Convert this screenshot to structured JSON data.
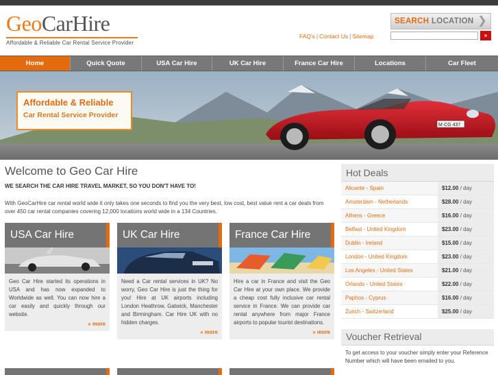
{
  "brand": {
    "logo_geo": "Geo",
    "logo_carhire": "CarHire",
    "tagline": "Affordable & Reliable Car Rental Service Provider"
  },
  "util_links": [
    "FAQ's",
    "Contact Us",
    "Sitemap"
  ],
  "search": {
    "label_part1": "SEARCH",
    "label_part2": "LOCATION",
    "go_label": "»",
    "placeholder": ""
  },
  "nav": [
    {
      "label": "Home",
      "active": true
    },
    {
      "label": "Quick Quote"
    },
    {
      "label": "USA Car Hire"
    },
    {
      "label": "UK Car Hire"
    },
    {
      "label": "France Car Hire"
    },
    {
      "label": "Locations"
    },
    {
      "label": "Car Fleet"
    }
  ],
  "banner": {
    "line1": "Affordable & Reliable",
    "line2": "Car Rental Service Provider",
    "plate": "M·CG 437"
  },
  "welcome": {
    "title": "Welcome to Geo Car Hire",
    "subtitle": "WE SEARCH THE CAR HIRE TRAVEL MARKET, SO YOU DON'T HAVE TO!",
    "body": "With GeoCarHire car rental world wide it only takes one seconds to find you the very best, low cost, best value rent a car deals from over 450 car rental companies covering 12,000 locations world wide in a 134 Countries."
  },
  "columns": [
    {
      "title": "USA Car Hire",
      "text": "Geo Car Hire started its operations in USA and has now expanded to Worldwide as well. You can now hire a car easily and quickly through our website.",
      "more": "» more"
    },
    {
      "title": "UK Car Hire",
      "text": "Need a Car rental services in UK? No worry, Geo Car Hire is just the thing for you! Hire at UK airports including London Heathrow, Gatwick, Manchester and Birmingham. Car Hire UK with no hidden charges.",
      "more": "» more"
    },
    {
      "title": "France Car Hire",
      "text": "Hire a car in France and visit the Geo Car Hire at your own place. We provide a cheap cost fully inclusive car rental service in France. We can provide car rental anywhere from major France airports to popular tourist destinations.",
      "more": "» more"
    }
  ],
  "hot_deals": {
    "title": "Hot Deals",
    "per": "/ day",
    "rows": [
      {
        "location": "Alicante - Spain",
        "price": "$12.00"
      },
      {
        "location": "Amsterdam - Netherlands",
        "price": "$28.00"
      },
      {
        "location": "Athens - Greece",
        "price": "$16.00"
      },
      {
        "location": "Belfast - United Kingdom",
        "price": "$23.00"
      },
      {
        "location": "Dublin - Ireland",
        "price": "$15.00"
      },
      {
        "location": "London - United Kingdom",
        "price": "$23.00"
      },
      {
        "location": "Los Angeles - United States",
        "price": "$21.00"
      },
      {
        "location": "Orlando - United States",
        "price": "$22.00"
      },
      {
        "location": "Paphos - Cyprus",
        "price": "$16.00"
      },
      {
        "location": "Zurich - Switzerland",
        "price": "$25.00"
      }
    ]
  },
  "voucher": {
    "title": "Voucher Retrieval",
    "text": "To get access to your voucher simply enter your Reference Number which will have been emailed to you."
  },
  "colors": {
    "accent": "#e36b0d",
    "nav_bg": "#787878",
    "panel_bg": "#ececec",
    "car_red": "#c4101a"
  }
}
